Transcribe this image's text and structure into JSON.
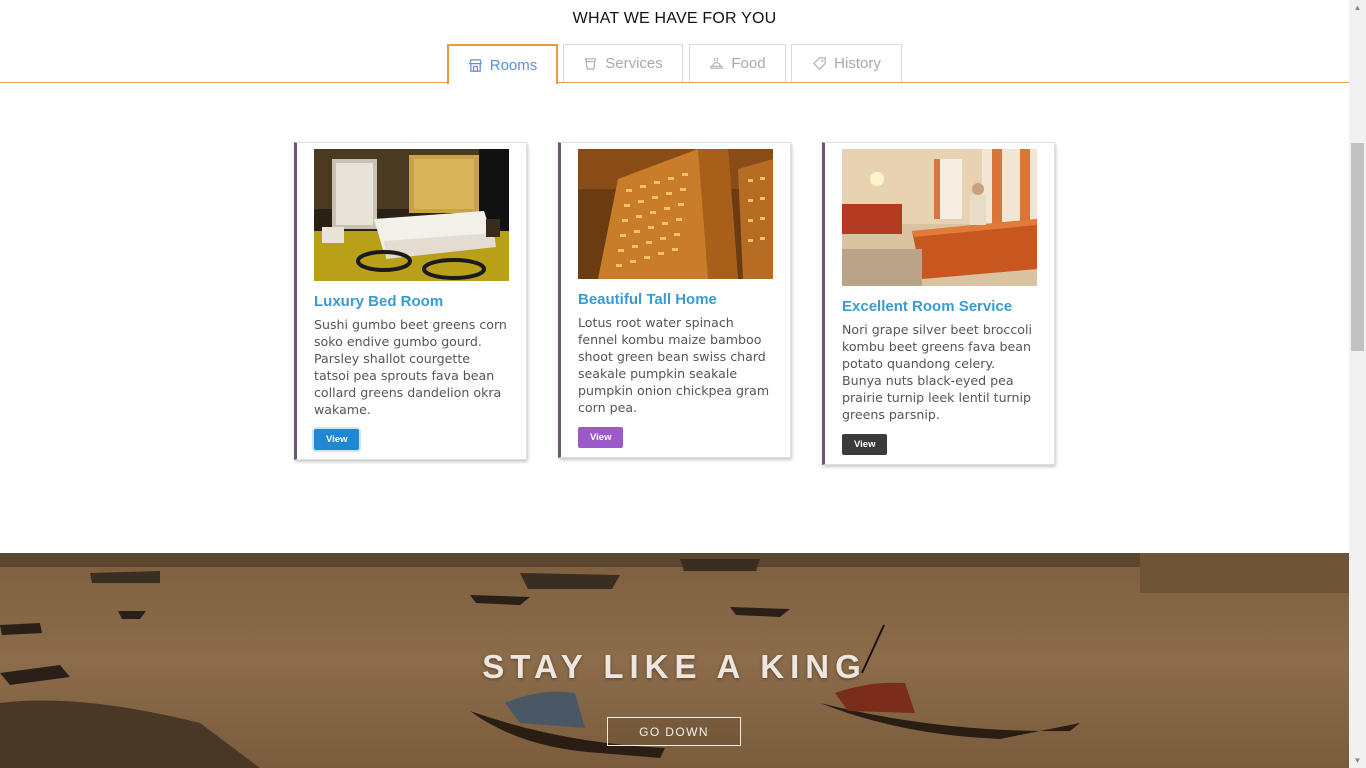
{
  "section": {
    "title": "WHAT WE HAVE FOR YOU"
  },
  "tabs": [
    {
      "label": "Rooms",
      "icon": "store-icon",
      "active": true
    },
    {
      "label": "Services",
      "icon": "cup-icon",
      "active": false
    },
    {
      "label": "Food",
      "icon": "food-tray-icon",
      "active": false
    },
    {
      "label": "History",
      "icon": "tag-icon",
      "active": false
    }
  ],
  "cards": [
    {
      "title": "Luxury Bed Room",
      "text": "Sushi gumbo beet greens corn soko endive gumbo gourd. Parsley shallot courgette tatsoi pea sprouts fava bean collard greens dandelion okra wakame.",
      "button": "View",
      "button_color": "#1e88d3",
      "image": "hotel bedroom photo"
    },
    {
      "title": "Beautiful Tall Home",
      "text": "Lotus root water spinach fennel kombu maize bamboo shoot green bean swiss chard seakale pumpkin seakale pumpkin onion chickpea gram corn pea.",
      "button": "View",
      "button_color": "#9b59c9",
      "image": "high-rise building at night photo"
    },
    {
      "title": "Excellent Room Service",
      "text": "Nori grape silver beet broccoli kombu beet greens fava bean potato quandong celery. Bunya nuts black-eyed pea prairie turnip leek lentil turnip greens parsnip.",
      "button": "View",
      "button_color": "#3b3b3b",
      "image": "hotel reception desk photo"
    }
  ],
  "hero": {
    "title": "STAY LIKE A KING",
    "button": "GO DOWN"
  },
  "colors": {
    "accent_orange": "#e99a3a",
    "tab_active_text": "#5b8fd6",
    "card_title": "#3a9bd1"
  }
}
